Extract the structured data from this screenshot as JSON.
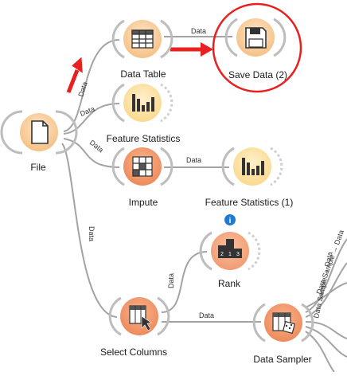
{
  "widgets": {
    "file": {
      "label": "File",
      "icon": "file-icon"
    },
    "data_table": {
      "label": "Data Table",
      "icon": "table-icon"
    },
    "save_data": {
      "label": "Save Data (2)",
      "icon": "floppy-disk-icon"
    },
    "feature_statistics": {
      "label": "Feature Statistics",
      "icon": "bar-chart-icon"
    },
    "impute": {
      "label": "Impute",
      "icon": "impute-grid-icon"
    },
    "feature_statistics_1": {
      "label": "Feature Statistics (1)",
      "icon": "bar-chart-icon"
    },
    "rank": {
      "label": "Rank",
      "icon": "podium-icon",
      "badge": "i"
    },
    "select_columns": {
      "label": "Select Columns",
      "icon": "select-columns-icon"
    },
    "data_sampler": {
      "label": "Data Sampler",
      "icon": "dice-table-icon"
    }
  },
  "edges": {
    "file_to_data_table": "Data",
    "file_to_feature_statistics": "Data",
    "file_to_impute": "Data",
    "file_to_select_columns": "Data",
    "data_table_to_save_data": "Data",
    "impute_to_feature_statistics_1": "Data",
    "select_columns_to_rank": "Data",
    "select_columns_to_data_sampler": "Data",
    "sampler_out_1": "Data Sample → Data",
    "sampler_out_2": "Data Sample → Data"
  },
  "colors": {
    "data_widget": "#f8c995",
    "data_widget_inner": "#fce0bd",
    "transform_widget": "#f39d73",
    "viz_widget": "#ffe6a8",
    "link": "#9e9e9e",
    "annotation_red": "#e8201f"
  }
}
